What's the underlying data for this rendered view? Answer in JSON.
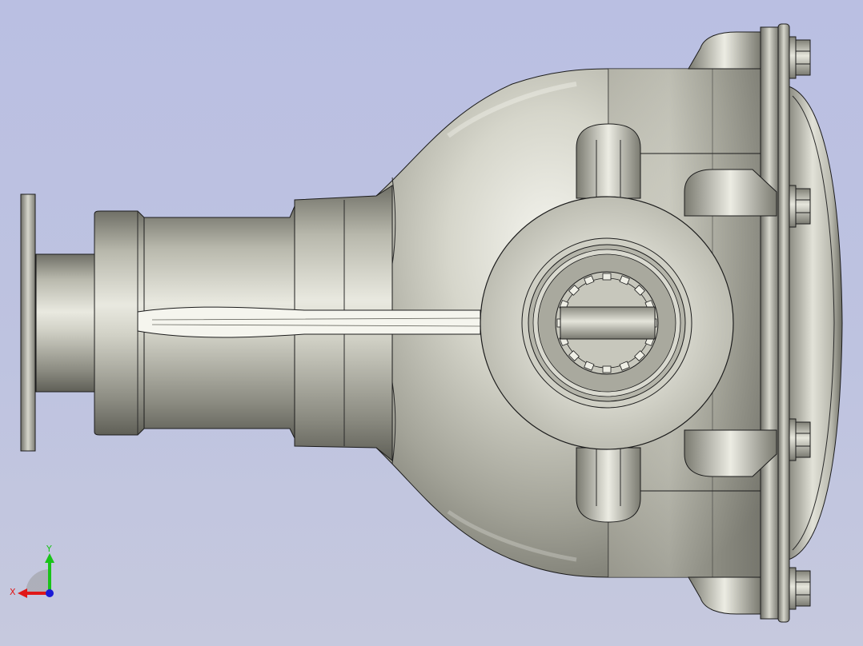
{
  "viewport": {
    "background": "#bcc1e0",
    "model_name": "",
    "shading": {
      "body_light": "#f2f2ec",
      "body_mid": "#b9b9ad",
      "body_dark": "#6d6d64",
      "edge": "#1c1c1c"
    }
  },
  "triad": {
    "x_label": "X",
    "y_label": "Y",
    "x_color": "#e01818",
    "y_color": "#19c319",
    "z_color": "#1a1ad6"
  }
}
